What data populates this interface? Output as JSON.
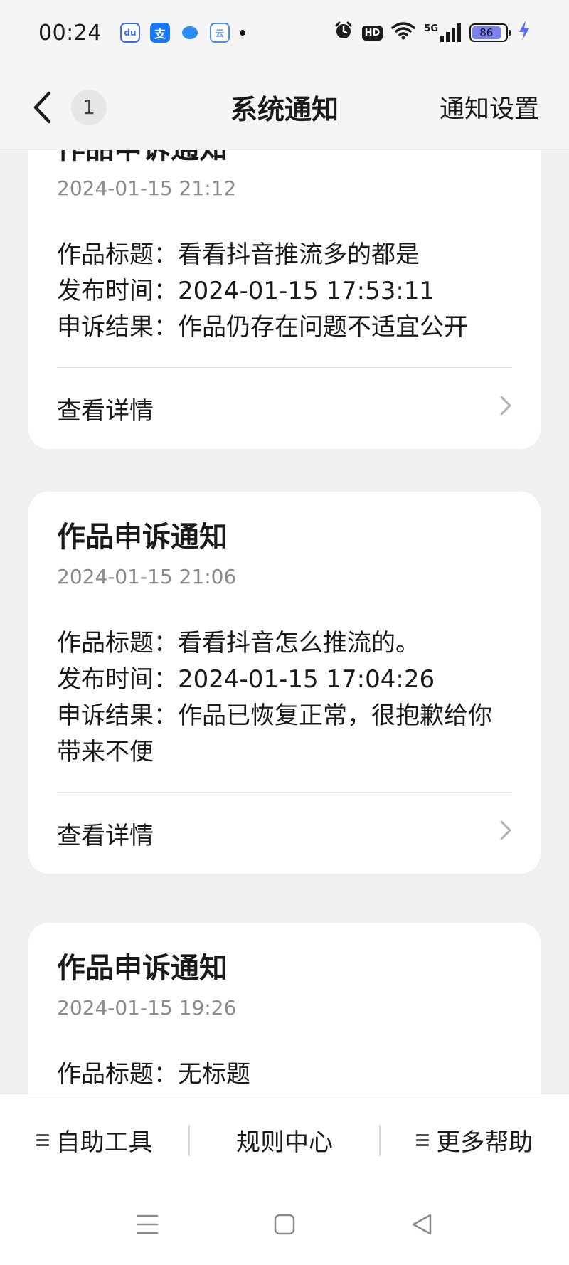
{
  "status_bar": {
    "time": "00:24",
    "apps": [
      "baidu-icon",
      "alipay-icon",
      "blue-app-icon",
      "cloud-app-icon"
    ],
    "alipay_glyph": "支",
    "baidu_glyph": "du",
    "cloud_glyph": "云",
    "hd_label": "HD",
    "signal_label": "5G",
    "battery_level": "86",
    "battery_color": "#7b7ff0"
  },
  "nav": {
    "back_label": "back",
    "count_badge": "1",
    "title": "系统通知",
    "action_label": "通知设置"
  },
  "cards": [
    {
      "title": "作品申诉通知",
      "time": "2024-01-15 21:12",
      "lines": [
        "作品标题：看看抖音推流多的都是",
        "发布时间：2024-01-15 17:53:11",
        "申诉结果：作品仍存在问题不适宜公开"
      ],
      "link_label": "查看详情"
    },
    {
      "title": "作品申诉通知",
      "time": "2024-01-15 21:06",
      "lines": [
        "作品标题：看看抖音怎么推流的。",
        "发布时间：2024-01-15 17:04:26",
        "申诉结果：作品已恢复正常，很抱歉给你",
        "带来不便"
      ],
      "link_label": "查看详情"
    },
    {
      "title": "作品申诉通知",
      "time": "2024-01-15 19:26",
      "lines": [
        "作品标题：无标题"
      ]
    }
  ],
  "bottom_bar": {
    "items": [
      "自助工具",
      "规则中心",
      "更多帮助"
    ]
  },
  "colors": {
    "background": "#f0f0f0",
    "card": "#ffffff",
    "secondary_text": "#8a8a8a"
  }
}
